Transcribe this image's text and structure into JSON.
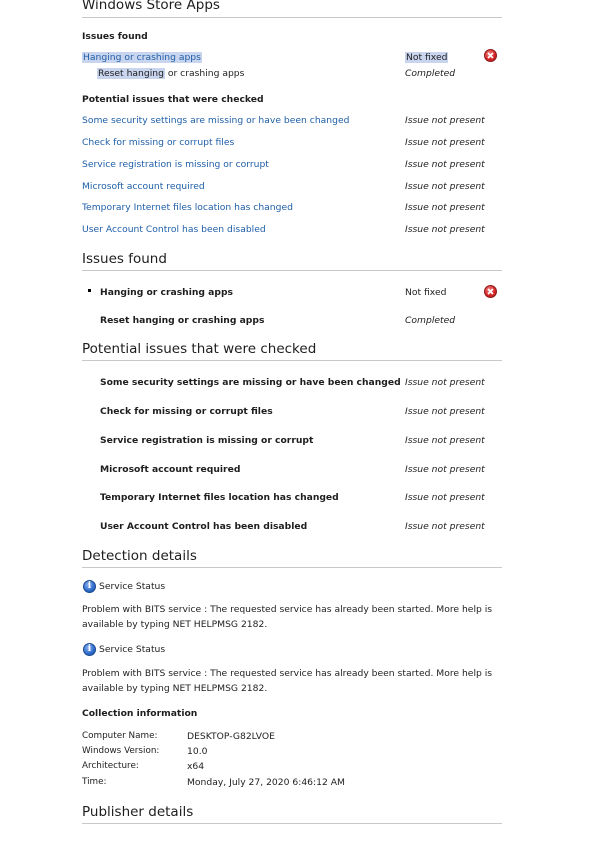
{
  "title": "Windows Store Apps",
  "summary": {
    "issues_found_label": "Issues found",
    "issue": {
      "name": "Hanging or crashing apps",
      "status": "Not fixed"
    },
    "sub": {
      "name_hl": "Reset hanging",
      "name_rest": " or crashing apps",
      "status": "Completed"
    },
    "potential_label": "Potential issues that were checked",
    "potential": [
      {
        "name": "Some security settings are missing or have been changed",
        "status": "Issue not present"
      },
      {
        "name": "Check for missing or corrupt files",
        "status": "Issue not present"
      },
      {
        "name": "Service registration is missing or corrupt",
        "status": "Issue not present"
      },
      {
        "name": "Microsoft account required",
        "status": "Issue not present"
      },
      {
        "name": "Temporary Internet files location has changed",
        "status": "Issue not present"
      },
      {
        "name": "User Account Control has been disabled",
        "status": "Issue not present"
      }
    ]
  },
  "issues_section": {
    "title": "Issues found",
    "issue": {
      "name": "Hanging or crashing apps",
      "status": "Not fixed"
    },
    "sub": {
      "name": "Reset hanging or crashing apps",
      "status": "Completed"
    }
  },
  "potential_section": {
    "title": "Potential issues that were checked",
    "items": [
      {
        "name": "Some security settings are missing or have been changed",
        "status": "Issue not present"
      },
      {
        "name": "Check for missing or corrupt files",
        "status": "Issue not present"
      },
      {
        "name": "Service registration is missing or corrupt",
        "status": "Issue not present"
      },
      {
        "name": "Microsoft account required",
        "status": "Issue not present"
      },
      {
        "name": "Temporary Internet files location has changed",
        "status": "Issue not present"
      },
      {
        "name": "User Account Control has been disabled",
        "status": "Issue not present"
      }
    ]
  },
  "detection": {
    "title": "Detection details",
    "entries": [
      {
        "heading": "Service Status",
        "text": "Problem with BITS service : The requested service has already been started. More help is available by typing NET HELPMSG 2182."
      },
      {
        "heading": "Service Status",
        "text": "Problem with BITS service : The requested service has already been started. More help is available by typing NET HELPMSG 2182."
      }
    ]
  },
  "collection": {
    "title": "Collection information",
    "rows": [
      {
        "label": "Computer Name:",
        "value": "DESKTOP-G82LVOE"
      },
      {
        "label": "Windows Version:",
        "value": "10.0"
      },
      {
        "label": "Architecture:",
        "value": "x64"
      },
      {
        "label": "Time:",
        "value": "Monday, July 27, 2020 6:46:12 AM"
      }
    ]
  },
  "publisher": {
    "title": "Publisher details"
  },
  "icons": {
    "error": "error-x-icon",
    "info": "info-icon"
  },
  "colors": {
    "link": "#1f5fa8",
    "highlight": "#c9d5ee",
    "error": "#d72828",
    "info": "#2c6ac9"
  }
}
